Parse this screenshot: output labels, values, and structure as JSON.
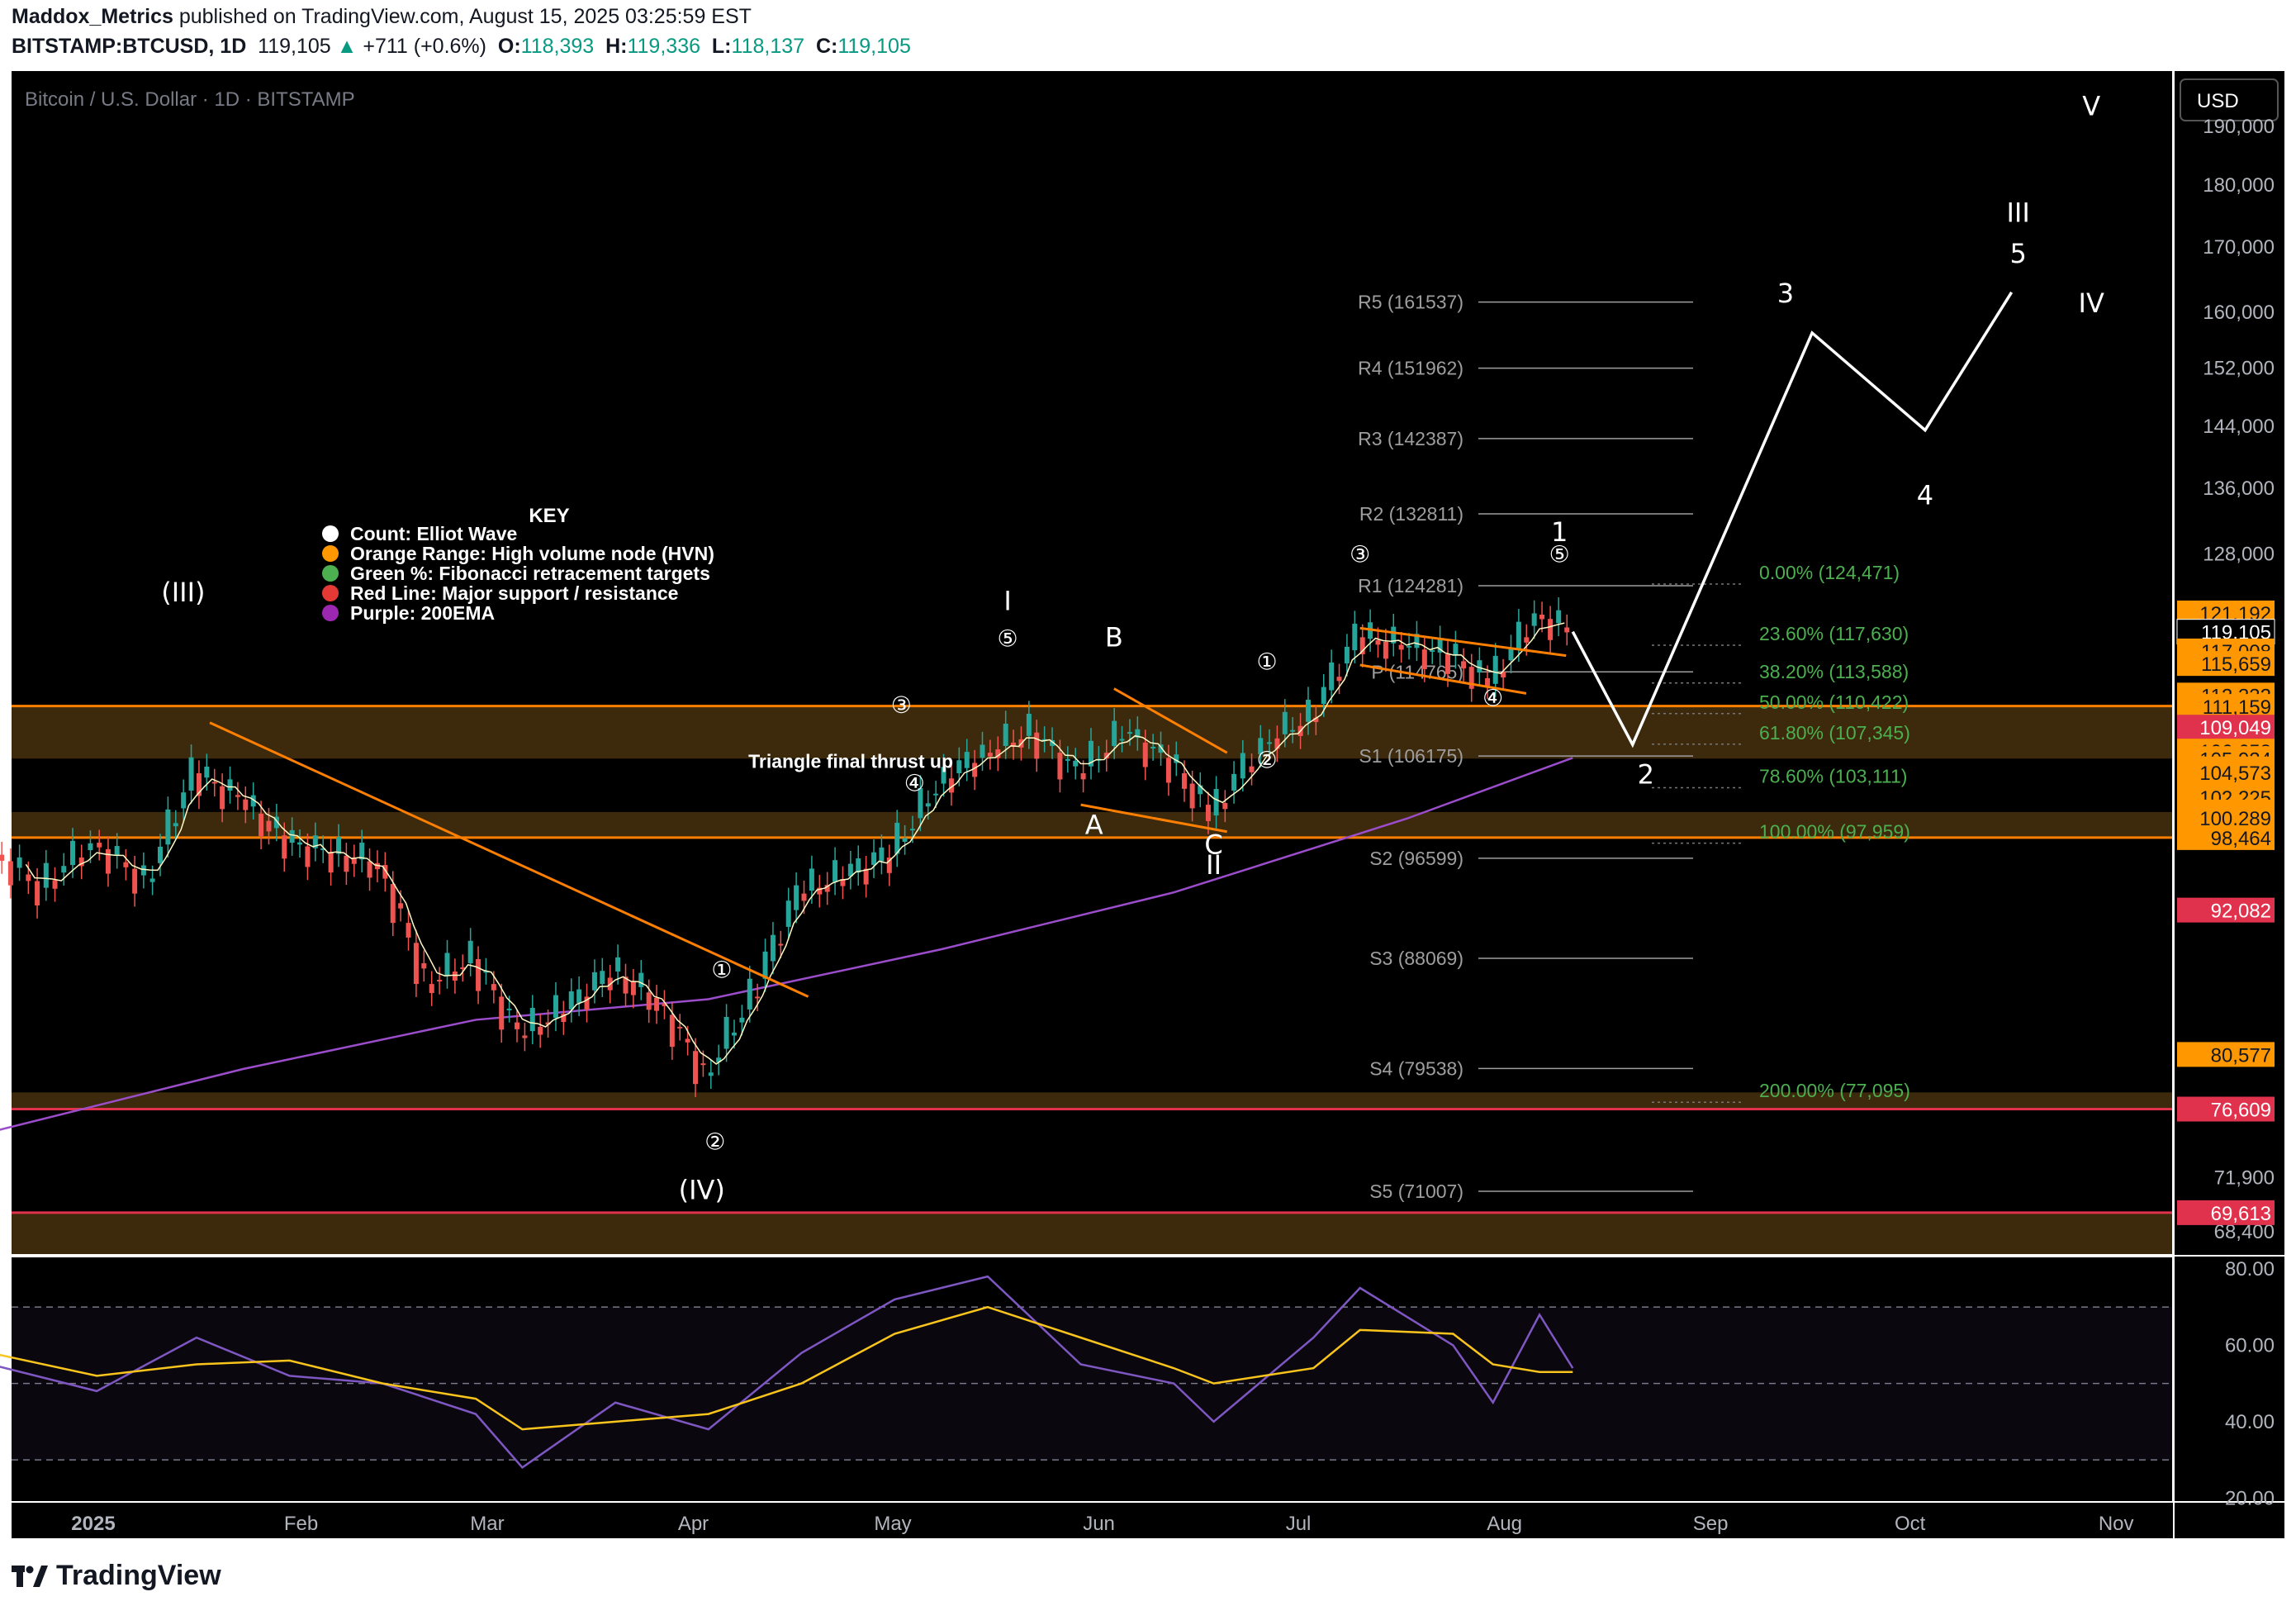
{
  "header": {
    "publisher": "Maddox_Metrics",
    "published_text": "published on TradingView.com, August 15, 2025 03:25:59 EST",
    "symbol": "BITSTAMP:BTCUSD, 1D",
    "last": "119,105",
    "change_arrow": "▲",
    "change": "+711 (+0.6%)",
    "o_label": "O:",
    "o_value": "118,393",
    "h_label": "H:",
    "h_value": "119,336",
    "l_label": "L:",
    "l_value": "118,137",
    "c_label": "C:",
    "c_value": "119,105"
  },
  "footer": {
    "brand": "TradingView",
    "brand_icon": "tradingview-logo-icon"
  },
  "colors": {
    "background": "#000000",
    "hvn_orange": "#ff7f00",
    "hvn_fill": "#3d2a0c",
    "red_line": "#e0314d",
    "ema_purple": "#9c4dcc",
    "fib_green": "#4caf50",
    "candle_up": "#26a69a",
    "candle_down": "#ef5350",
    "rsi": "#7e57c2",
    "rsi_ma": "#f9c41c",
    "white": "#ffffff"
  },
  "chart_data": {
    "type": "line",
    "title": "Bitcoin / U.S. Dollar · 1D · BITSTAMP",
    "currency_button": "USD",
    "price_scale": "log",
    "ylim": [
      67000,
      200000
    ],
    "y_ticks": [
      "190,000",
      "180,000",
      "170,000",
      "160,000",
      "152,000",
      "144,000",
      "136,000",
      "128,000",
      "119,105",
      "111,159",
      "104,920",
      "98,464",
      "71,900",
      "68,400"
    ],
    "x_ticks": [
      "2025",
      "Feb",
      "Mar",
      "Apr",
      "May",
      "Jun",
      "Jul",
      "Aug",
      "Sep",
      "Oct",
      "Nov"
    ],
    "price_series": {
      "name": "BTCUSD",
      "x": [
        "2024-12-20",
        "2024-12-28",
        "2025-01-05",
        "2025-01-13",
        "2025-01-20",
        "2025-01-27",
        "2025-02-03",
        "2025-02-10",
        "2025-02-17",
        "2025-02-24",
        "2025-03-03",
        "2025-03-10",
        "2025-03-17",
        "2025-03-24",
        "2025-03-31",
        "2025-04-07",
        "2025-04-14",
        "2025-04-21",
        "2025-04-28",
        "2025-05-05",
        "2025-05-12",
        "2025-05-19",
        "2025-05-26",
        "2025-06-02",
        "2025-06-09",
        "2025-06-16",
        "2025-06-22",
        "2025-06-30",
        "2025-07-07",
        "2025-07-14",
        "2025-07-21",
        "2025-07-28",
        "2025-08-03",
        "2025-08-10",
        "2025-08-15"
      ],
      "close": [
        97500,
        94000,
        98000,
        94500,
        104500,
        102000,
        98000,
        97000,
        96000,
        86000,
        88000,
        82000,
        84000,
        87000,
        84500,
        79000,
        85000,
        93500,
        95000,
        97000,
        103500,
        106500,
        108500,
        104500,
        108500,
        105500,
        100500,
        107500,
        110000,
        118500,
        117500,
        116500,
        113500,
        121000,
        119105
      ]
    },
    "ema200": {
      "name": "200EMA",
      "x": [
        "2024-12-20",
        "2025-01-27",
        "2025-03-03",
        "2025-04-07",
        "2025-05-12",
        "2025-06-16",
        "2025-07-21",
        "2025-08-15"
      ],
      "values": [
        75000,
        79500,
        83200,
        84800,
        88800,
        93600,
        100200,
        106000
      ]
    },
    "projection": {
      "x": [
        "2025-08-15",
        "2025-08-24",
        "2025-09-20",
        "2025-10-07",
        "2025-10-20"
      ],
      "values": [
        119105,
        107300,
        157000,
        143500,
        163000
      ]
    },
    "pivots": [
      {
        "label": "R5 (161537)",
        "value": 161537
      },
      {
        "label": "R4 (151962)",
        "value": 151962
      },
      {
        "label": "R3 (142387)",
        "value": 142387
      },
      {
        "label": "R2 (132811)",
        "value": 132811
      },
      {
        "label": "R1 (124281)",
        "value": 124281
      },
      {
        "label": "P (114765)",
        "value": 114765
      },
      {
        "label": "S1 (106175)",
        "value": 106175
      },
      {
        "label": "S2 (96599)",
        "value": 96599
      },
      {
        "label": "S3 (88069)",
        "value": 88069
      },
      {
        "label": "S4 (79538)",
        "value": 79538
      },
      {
        "label": "S5 (71007)",
        "value": 71007
      }
    ],
    "fib_levels": [
      {
        "label": "0.00% (124,471)",
        "value": 124471
      },
      {
        "label": "23.60% (117,630)",
        "value": 117630
      },
      {
        "label": "38.20% (113,588)",
        "value": 113588
      },
      {
        "label": "50.00% (110,422)",
        "value": 110422
      },
      {
        "label": "61.80% (107,345)",
        "value": 107345
      },
      {
        "label": "78.60% (103,111)",
        "value": 103111
      },
      {
        "label": "100.00% (97,959)",
        "value": 97959
      },
      {
        "label": "200.00% (77,095)",
        "value": 77095
      }
    ],
    "hvn_zones": [
      [
        105924,
        111159
      ],
      [
        98464,
        100821
      ],
      [
        76609,
        77800
      ],
      [
        66500,
        69613
      ]
    ],
    "red_lines": [
      111200,
      98464,
      76609,
      69613
    ],
    "price_labels": [
      {
        "text": "121,192",
        "value": 121192,
        "color": "#ff9800"
      },
      {
        "text": "119,105",
        "value": 119105,
        "color": "#ffffff"
      },
      {
        "text": "117,008",
        "value": 117008,
        "color": "#ff9800"
      },
      {
        "text": "115,659",
        "value": 115659,
        "color": "#ff9800"
      },
      {
        "text": "112,332",
        "value": 112332,
        "color": "#ff9800"
      },
      {
        "text": "111,159",
        "value": 111159,
        "color": "#ff9800"
      },
      {
        "text": "109,049",
        "value": 109049,
        "color": "#e0314d"
      },
      {
        "text": "106,658",
        "value": 106658,
        "color": "#ff9800"
      },
      {
        "text": "105,924",
        "value": 105924,
        "color": "#ff9800"
      },
      {
        "text": "104,920",
        "value": 104920,
        "color": "#ff9800"
      },
      {
        "text": "104,573",
        "value": 104573,
        "color": "#ff9800"
      },
      {
        "text": "102,225",
        "value": 102225,
        "color": "#ff9800"
      },
      {
        "text": "100,821",
        "value": 100821,
        "color": "#ff9800"
      },
      {
        "text": "100,289",
        "value": 100289,
        "color": "#ff9800"
      },
      {
        "text": "98,464",
        "value": 98464,
        "color": "#ff9800"
      },
      {
        "text": "92,082",
        "value": 92082,
        "color": "#e0314d"
      },
      {
        "text": "80,577",
        "value": 80577,
        "color": "#ff9800"
      },
      {
        "text": "76,609",
        "value": 76609,
        "color": "#e0314d"
      },
      {
        "text": "69,613",
        "value": 69613,
        "color": "#e0314d"
      }
    ],
    "wave_labels": [
      {
        "text": "(III)",
        "x": "2025-01-18",
        "value": 122500
      },
      {
        "text": "(IV)",
        "x": "2025-04-06",
        "value": 70500
      },
      {
        "text": "I",
        "x": "2025-05-22",
        "value": 121500
      },
      {
        "text": "II",
        "x": "2025-06-22",
        "value": 95200
      },
      {
        "text": "A",
        "x": "2025-06-04",
        "value": 98800
      },
      {
        "text": "B",
        "x": "2025-06-07",
        "value": 117500
      },
      {
        "text": "C",
        "x": "2025-06-22",
        "value": 97000
      },
      {
        "text": "1",
        "x": "2025-08-13",
        "value": 129500
      },
      {
        "text": "2",
        "x": "2025-08-26",
        "value": 103500
      },
      {
        "text": "3",
        "x": "2025-09-16",
        "value": 161500
      },
      {
        "text": "4",
        "x": "2025-10-07",
        "value": 134000
      },
      {
        "text": "III",
        "x": "2025-10-21",
        "value": 174000
      },
      {
        "text": "5",
        "x": "2025-10-21",
        "value": 167500
      },
      {
        "text": "IV",
        "x": "2025-11-01",
        "value": 160000
      },
      {
        "text": "V",
        "x": "2025-11-01",
        "value": 192000
      }
    ],
    "circled_labels": [
      {
        "text": "①",
        "x": "2025-04-09",
        "value": 86500
      },
      {
        "text": "②",
        "x": "2025-04-08",
        "value": 73800
      },
      {
        "text": "③",
        "x": "2025-05-06",
        "value": 110500
      },
      {
        "text": "④",
        "x": "2025-05-08",
        "value": 102800
      },
      {
        "text": "⑤",
        "x": "2025-05-22",
        "value": 117500
      },
      {
        "text": "①",
        "x": "2025-06-30",
        "value": 115000
      },
      {
        "text": "②",
        "x": "2025-06-30",
        "value": 105000
      },
      {
        "text": "③",
        "x": "2025-07-14",
        "value": 127000
      },
      {
        "text": "④",
        "x": "2025-08-03",
        "value": 111200
      },
      {
        "text": "⑤",
        "x": "2025-08-13",
        "value": 127000
      }
    ],
    "annotations": [
      {
        "text": "Triangle final thrust up",
        "x": "2025-04-13",
        "value": 105000
      }
    ],
    "key": {
      "title": "KEY",
      "items": [
        {
          "dot": "#ffffff",
          "text": "Count: Elliot Wave"
        },
        {
          "dot": "#ff9800",
          "text": "Orange Range: High volume node (HVN)"
        },
        {
          "dot": "#4caf50",
          "text": "Green %: Fibonacci retracement targets"
        },
        {
          "dot": "#e53935",
          "text": "Red Line: Major support / resistance"
        },
        {
          "dot": "#9c27b0",
          "text": "Purple: 200EMA"
        }
      ]
    },
    "rsi": {
      "y_ticks": [
        "80.00",
        "60.00",
        "40.00",
        "20.00"
      ],
      "ylim": [
        19,
        83
      ],
      "levels": [
        70,
        50,
        30
      ],
      "x": [
        "2024-12-20",
        "2025-01-05",
        "2025-01-20",
        "2025-02-03",
        "2025-02-17",
        "2025-03-03",
        "2025-03-10",
        "2025-03-24",
        "2025-04-07",
        "2025-04-21",
        "2025-05-05",
        "2025-05-19",
        "2025-06-02",
        "2025-06-16",
        "2025-06-22",
        "2025-07-07",
        "2025-07-14",
        "2025-07-28",
        "2025-08-03",
        "2025-08-10",
        "2025-08-15"
      ],
      "values": [
        55,
        48,
        62,
        52,
        50,
        42,
        28,
        45,
        38,
        58,
        72,
        78,
        55,
        50,
        40,
        62,
        75,
        60,
        45,
        68,
        54
      ],
      "ma_values": [
        58,
        52,
        55,
        56,
        50,
        46,
        38,
        40,
        42,
        50,
        63,
        70,
        62,
        54,
        50,
        54,
        64,
        63,
        55,
        53,
        53
      ]
    }
  }
}
